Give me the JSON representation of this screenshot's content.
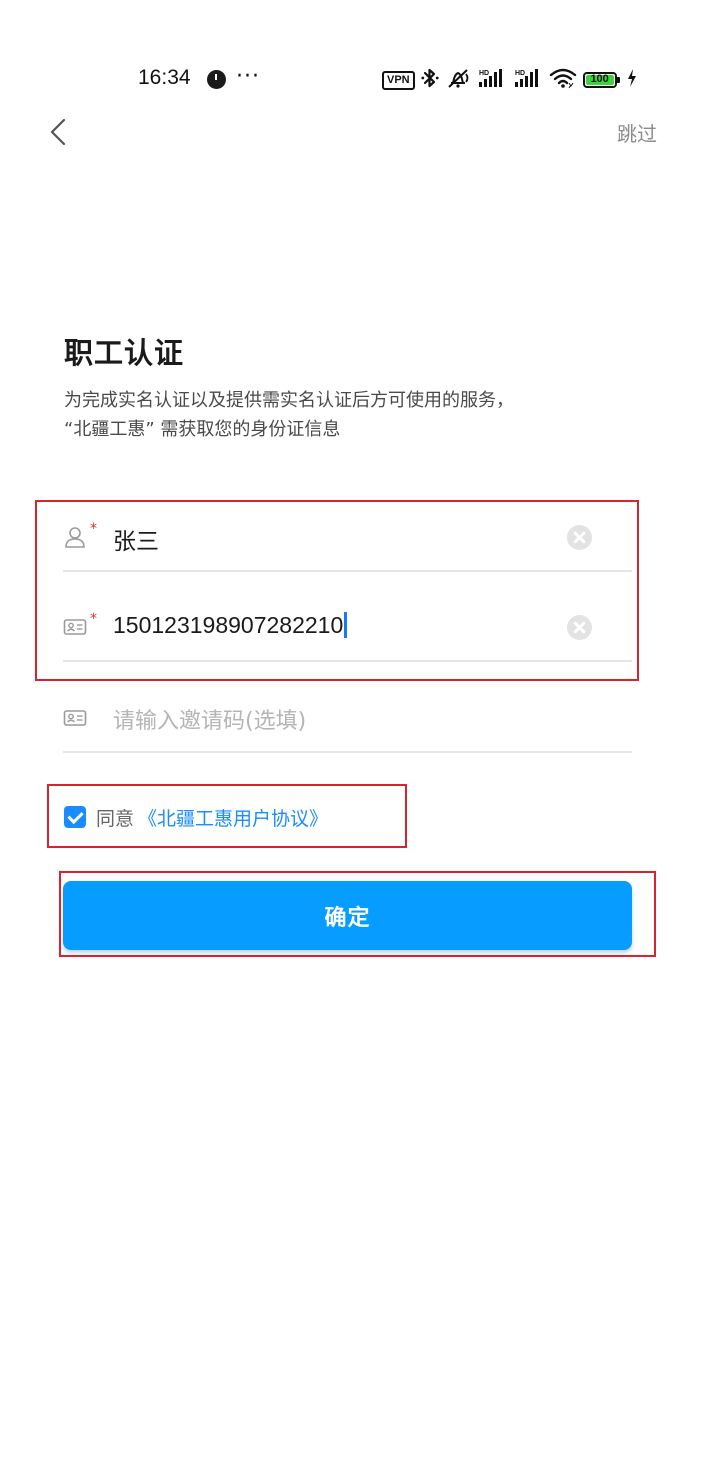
{
  "status_bar": {
    "time": "16:34",
    "more": "···",
    "vpn": "VPN",
    "battery": "100",
    "battery_level": 1.0
  },
  "nav": {
    "skip_label": "跳过"
  },
  "header": {
    "title": "职工认证",
    "description_line1": "为完成实名认证以及提供需实名认证后方可使用的服务，",
    "description_line2": "“北疆工惠” 需获取您的身份证信息"
  },
  "form": {
    "name_value": "张三",
    "id_value": "150123198907282210",
    "invite_placeholder": "请输入邀请码(选填)",
    "required_mark": "*"
  },
  "agreement": {
    "agree_label": "同意",
    "link_label": "《北疆工惠用户协议》",
    "checked": true
  },
  "actions": {
    "confirm_label": "确定"
  },
  "colors": {
    "accent": "#079cff",
    "link": "#1a8cff",
    "highlight": "#d9232e"
  }
}
